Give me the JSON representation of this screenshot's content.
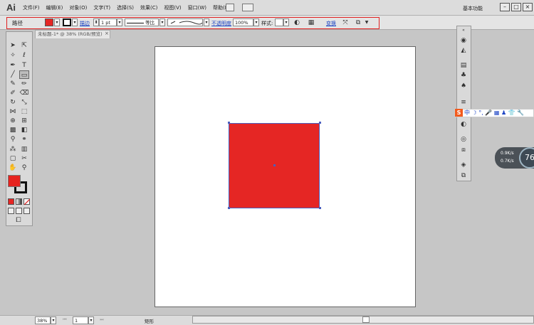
{
  "app": {
    "logo": "Ai",
    "workspace_label": "基本功能"
  },
  "menu": [
    "文件(F)",
    "编辑(E)",
    "对象(O)",
    "文字(T)",
    "选择(S)",
    "效果(C)",
    "视图(V)",
    "窗口(W)",
    "帮助(H)"
  ],
  "window_buttons": {
    "minimize": "–",
    "restore": "□",
    "close": "×"
  },
  "control_bar": {
    "selection_label": "路径",
    "fill_color": "#e52624",
    "stroke_link_label": "描边",
    "stroke_weight": "1 pt",
    "stroke_profile_label": "等比",
    "opacity_label": "不透明度",
    "opacity_value": "100%",
    "style_label": "样式:",
    "transform_link": "变换"
  },
  "document": {
    "tab_title": "未标题-1* @ 38% (RGB/预览)",
    "close_glyph": "×"
  },
  "artwork": {
    "shape": "rectangle",
    "fill": "#e52624",
    "selection_color": "#4a5fbf"
  },
  "status": {
    "zoom": "38%",
    "page": "1",
    "tool_name": "矩形"
  },
  "ime": {
    "logo": "S",
    "text": "中 ☽ °, 🎤 ▦ ♟ 👕 🔧"
  },
  "speed": {
    "up": "0.9K/s",
    "down": "0.7K/s",
    "percent": "76"
  },
  "colors": {
    "accent_red": "#e02020",
    "link_blue": "#1c44c4"
  }
}
